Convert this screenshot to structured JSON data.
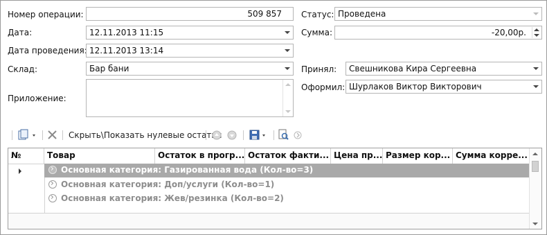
{
  "labels": {
    "op_number": "Номер операции:",
    "date": "Дата:",
    "posting_date": "Дата проведения:",
    "warehouse": "Склад:",
    "attachment": "Приложение:",
    "status": "Статус:",
    "sum": "Сумма:",
    "accepted": "Принял:",
    "issued": "Оформил:"
  },
  "values": {
    "op_number": "509 857",
    "date": "12.11.2013 11:15",
    "posting_date": "12.11.2013 13:14",
    "warehouse": "Бар бани",
    "attachment": "",
    "status": "Проведена",
    "sum": "-20,00р.",
    "accepted": "Свешникова  Кира Сергеевна",
    "issued": "Шурлаков Виктор Викторович"
  },
  "toolbar": {
    "toggle_zero_label": "Скрыть\\Показать нулевые остатки"
  },
  "icons": {
    "new": "new-document-icon",
    "delete": "delete-icon",
    "up": "move-up-icon",
    "down": "move-down-icon",
    "save": "save-icon",
    "search": "search-icon",
    "go": "go-icon"
  },
  "grid": {
    "columns": [
      "№",
      "Товар",
      "Остаток в прогр...",
      "Остаток факти...",
      "Цена пр...",
      "Размер кор...",
      "Сумма корре..."
    ],
    "groups": [
      {
        "label": "Основная категория: Газированная вода (Кол-во=3)",
        "selected": true
      },
      {
        "label": "Основная категория: Доп/услуги (Кол-во=1)",
        "selected": false
      },
      {
        "label": "Основная категория: Жев/резинка (Кол-во=2)",
        "selected": false
      }
    ]
  },
  "colors": {
    "selected_row": "#a9a9a9",
    "muted_text": "#8d8d8d"
  }
}
